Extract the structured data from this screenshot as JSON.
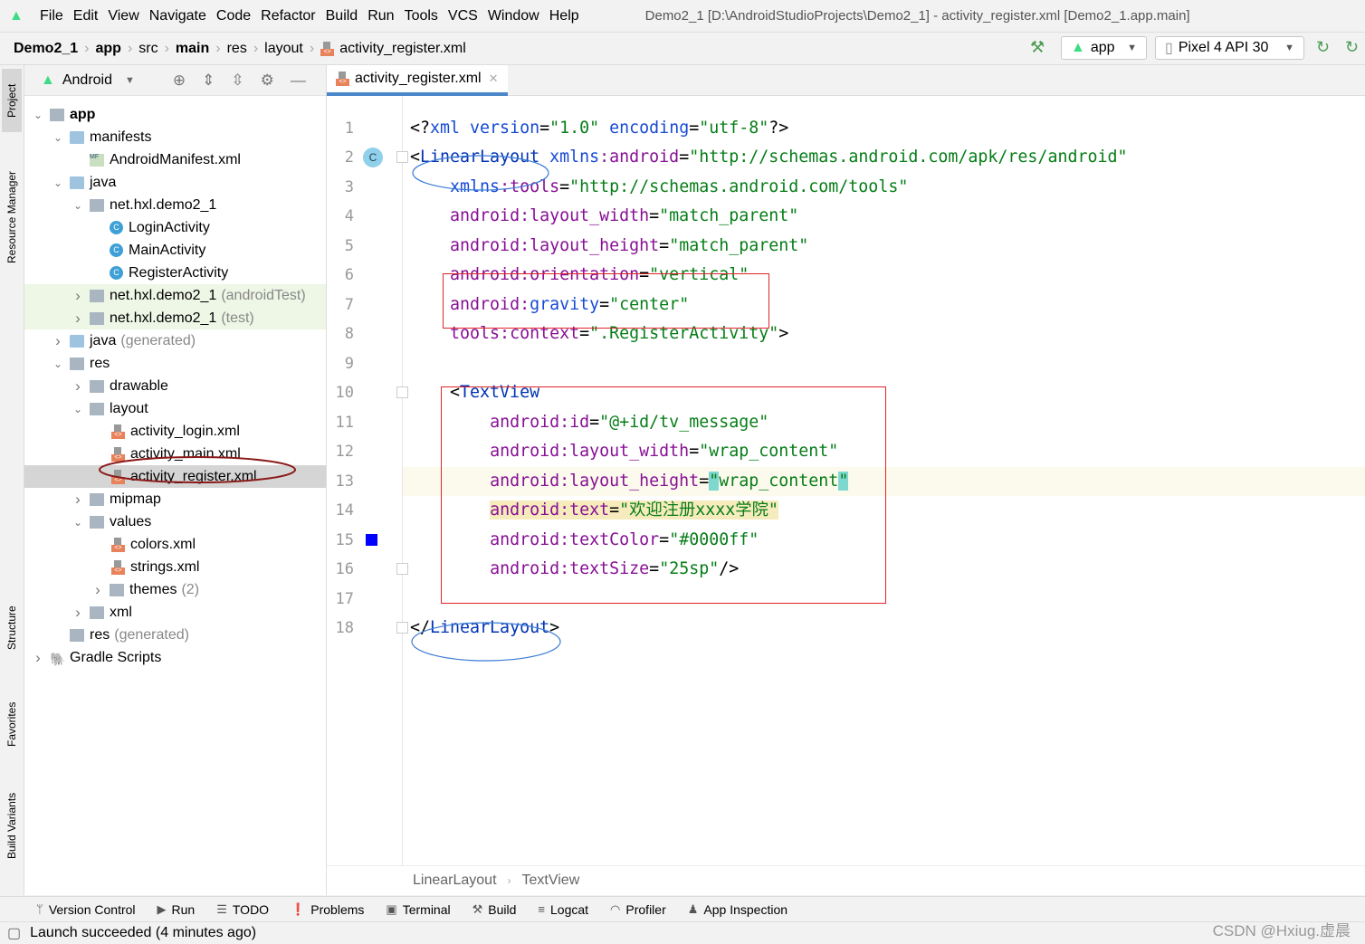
{
  "window_title": "Demo2_1 [D:\\AndroidStudioProjects\\Demo2_1] - activity_register.xml [Demo2_1.app.main]",
  "menu": [
    "File",
    "Edit",
    "View",
    "Navigate",
    "Code",
    "Refactor",
    "Build",
    "Run",
    "Tools",
    "VCS",
    "Window",
    "Help"
  ],
  "breadcrumb": [
    {
      "label": "Demo2_1",
      "bold": true
    },
    {
      "label": "app",
      "bold": true
    },
    {
      "label": "src"
    },
    {
      "label": "main",
      "bold": true
    },
    {
      "label": "res"
    },
    {
      "label": "layout"
    },
    {
      "label": "activity_register.xml",
      "file": true
    }
  ],
  "run_config": "app",
  "device": "Pixel 4 API 30",
  "left_strip": [
    "Project",
    "Resource Manager",
    "Structure",
    "Favorites",
    "Build Variants"
  ],
  "project": {
    "view": "Android",
    "tree": [
      {
        "label": "app",
        "level": 0,
        "arrow": "down",
        "icon": "module",
        "bold": true
      },
      {
        "label": "manifests",
        "level": 1,
        "arrow": "down",
        "icon": "folder"
      },
      {
        "label": "AndroidManifest.xml",
        "level": 2,
        "icon": "mf"
      },
      {
        "label": "java",
        "level": 1,
        "arrow": "down",
        "icon": "folder"
      },
      {
        "label": "net.hxl.demo2_1",
        "level": 2,
        "arrow": "down",
        "icon": "pkg"
      },
      {
        "label": "LoginActivity",
        "level": 3,
        "icon": "class"
      },
      {
        "label": "MainActivity",
        "level": 3,
        "icon": "class"
      },
      {
        "label": "RegisterActivity",
        "level": 3,
        "icon": "class"
      },
      {
        "label": "net.hxl.demo2_1",
        "suffix": "(androidTest)",
        "level": 2,
        "arrow": "right",
        "icon": "pkg",
        "green": true
      },
      {
        "label": "net.hxl.demo2_1",
        "suffix": "(test)",
        "level": 2,
        "arrow": "right",
        "icon": "pkg",
        "green": true
      },
      {
        "label": "java",
        "suffix": "(generated)",
        "level": 1,
        "arrow": "right",
        "icon": "folder"
      },
      {
        "label": "res",
        "level": 1,
        "arrow": "down",
        "icon": "pkg"
      },
      {
        "label": "drawable",
        "level": 2,
        "arrow": "right",
        "icon": "pkg"
      },
      {
        "label": "layout",
        "level": 2,
        "arrow": "down",
        "icon": "pkg"
      },
      {
        "label": "activity_login.xml",
        "level": 3,
        "icon": "xml"
      },
      {
        "label": "activity_main.xml",
        "level": 3,
        "icon": "xml"
      },
      {
        "label": "activity_register.xml",
        "level": 3,
        "icon": "xml",
        "selected": true
      },
      {
        "label": "mipmap",
        "level": 2,
        "arrow": "right",
        "icon": "pkg"
      },
      {
        "label": "values",
        "level": 2,
        "arrow": "down",
        "icon": "pkg"
      },
      {
        "label": "colors.xml",
        "level": 3,
        "icon": "xml"
      },
      {
        "label": "strings.xml",
        "level": 3,
        "icon": "xml"
      },
      {
        "label": "themes",
        "suffix": "(2)",
        "level": 3,
        "arrow": "right",
        "icon": "pkg"
      },
      {
        "label": "xml",
        "level": 2,
        "arrow": "right",
        "icon": "pkg"
      },
      {
        "label": "res",
        "suffix": "(generated)",
        "level": 1,
        "icon": "pkg"
      },
      {
        "label": "Gradle Scripts",
        "level": 0,
        "arrow": "right",
        "icon": "gradle"
      }
    ]
  },
  "editor": {
    "tab": "activity_register.xml",
    "lines": [
      [
        [
          "p",
          "<?"
        ],
        [
          "blue",
          "xml version"
        ],
        [
          "p",
          "="
        ],
        [
          "val",
          "\"1.0\""
        ],
        [
          "p",
          " "
        ],
        [
          "blue",
          "encoding"
        ],
        [
          "p",
          "="
        ],
        [
          "val",
          "\"utf-8\""
        ],
        [
          "p",
          "?>"
        ]
      ],
      [
        [
          "p",
          "<"
        ],
        [
          "tag",
          "LinearLayout"
        ],
        [
          "p",
          " "
        ],
        [
          "blue",
          "xmlns"
        ],
        [
          "attr",
          ":android"
        ],
        [
          "p",
          "="
        ],
        [
          "val",
          "\"http://schemas.android.com/apk/res/android\""
        ]
      ],
      [
        [
          "p",
          "    "
        ],
        [
          "blue",
          "xmlns"
        ],
        [
          "attr",
          ":tools"
        ],
        [
          "p",
          "="
        ],
        [
          "val",
          "\"http://schemas.android.com/tools\""
        ]
      ],
      [
        [
          "p",
          "    "
        ],
        [
          "attr",
          "android:layout_width"
        ],
        [
          "p",
          "="
        ],
        [
          "val",
          "\"match_parent\""
        ]
      ],
      [
        [
          "p",
          "    "
        ],
        [
          "attr",
          "android:layout_height"
        ],
        [
          "p",
          "="
        ],
        [
          "val",
          "\"match_parent\""
        ]
      ],
      [
        [
          "p",
          "    "
        ],
        [
          "attr",
          "android:orientation"
        ],
        [
          "p",
          "="
        ],
        [
          "val",
          "\"vertical\""
        ]
      ],
      [
        [
          "p",
          "    "
        ],
        [
          "attr",
          "android:"
        ],
        [
          "blue",
          "gravity"
        ],
        [
          "p",
          "="
        ],
        [
          "val",
          "\"center\""
        ]
      ],
      [
        [
          "p",
          "    "
        ],
        [
          "attr",
          "tools:context"
        ],
        [
          "p",
          "="
        ],
        [
          "val",
          "\".RegisterActivity\""
        ],
        [
          "p",
          ">"
        ]
      ],
      [],
      [
        [
          "p",
          "    <"
        ],
        [
          "tag",
          "TextView"
        ]
      ],
      [
        [
          "p",
          "        "
        ],
        [
          "attr",
          "android:id"
        ],
        [
          "p",
          "="
        ],
        [
          "val",
          "\"@+id/tv_message\""
        ]
      ],
      [
        [
          "p",
          "        "
        ],
        [
          "attr",
          "android:layout_width"
        ],
        [
          "p",
          "="
        ],
        [
          "val",
          "\"wrap_content\""
        ]
      ],
      [
        [
          "p",
          "        "
        ],
        [
          "attr",
          "android:layout_height"
        ],
        [
          "p",
          "="
        ],
        [
          "val",
          "\"",
          "q"
        ],
        [
          "val",
          "wrap_content"
        ],
        [
          "val",
          "\"",
          "q"
        ]
      ],
      [
        [
          "p",
          "        "
        ],
        [
          "attr",
          "android:text",
          "y"
        ],
        [
          "p",
          "=",
          "y"
        ],
        [
          "val",
          "\"欢迎注册xxxx学院\"",
          "y"
        ]
      ],
      [
        [
          "p",
          "        "
        ],
        [
          "attr",
          "android:textColor"
        ],
        [
          "p",
          "="
        ],
        [
          "val",
          "\"#0000ff\""
        ]
      ],
      [
        [
          "p",
          "        "
        ],
        [
          "attr",
          "android:textSize"
        ],
        [
          "p",
          "="
        ],
        [
          "val",
          "\"25sp\""
        ],
        [
          "p",
          "/>"
        ]
      ],
      [],
      [
        [
          "p",
          "</"
        ],
        [
          "tag",
          "LinearLayout"
        ],
        [
          "p",
          ">"
        ]
      ]
    ],
    "current_line": 13,
    "color_swatch_line": 15,
    "swatch_color": "#0000ff",
    "breadcrumb": [
      "LinearLayout",
      "TextView"
    ]
  },
  "tool_windows": [
    "Version Control",
    "Run",
    "TODO",
    "Problems",
    "Terminal",
    "Build",
    "Logcat",
    "Profiler",
    "App Inspection"
  ],
  "status": "Launch succeeded (4 minutes ago)",
  "watermark": "CSDN @Hxiug.虚晨",
  "colors": {
    "annotation_red": "#e0242c",
    "annotation_blue": "#3b7bd4",
    "tab_underline": "#4a86c8"
  }
}
